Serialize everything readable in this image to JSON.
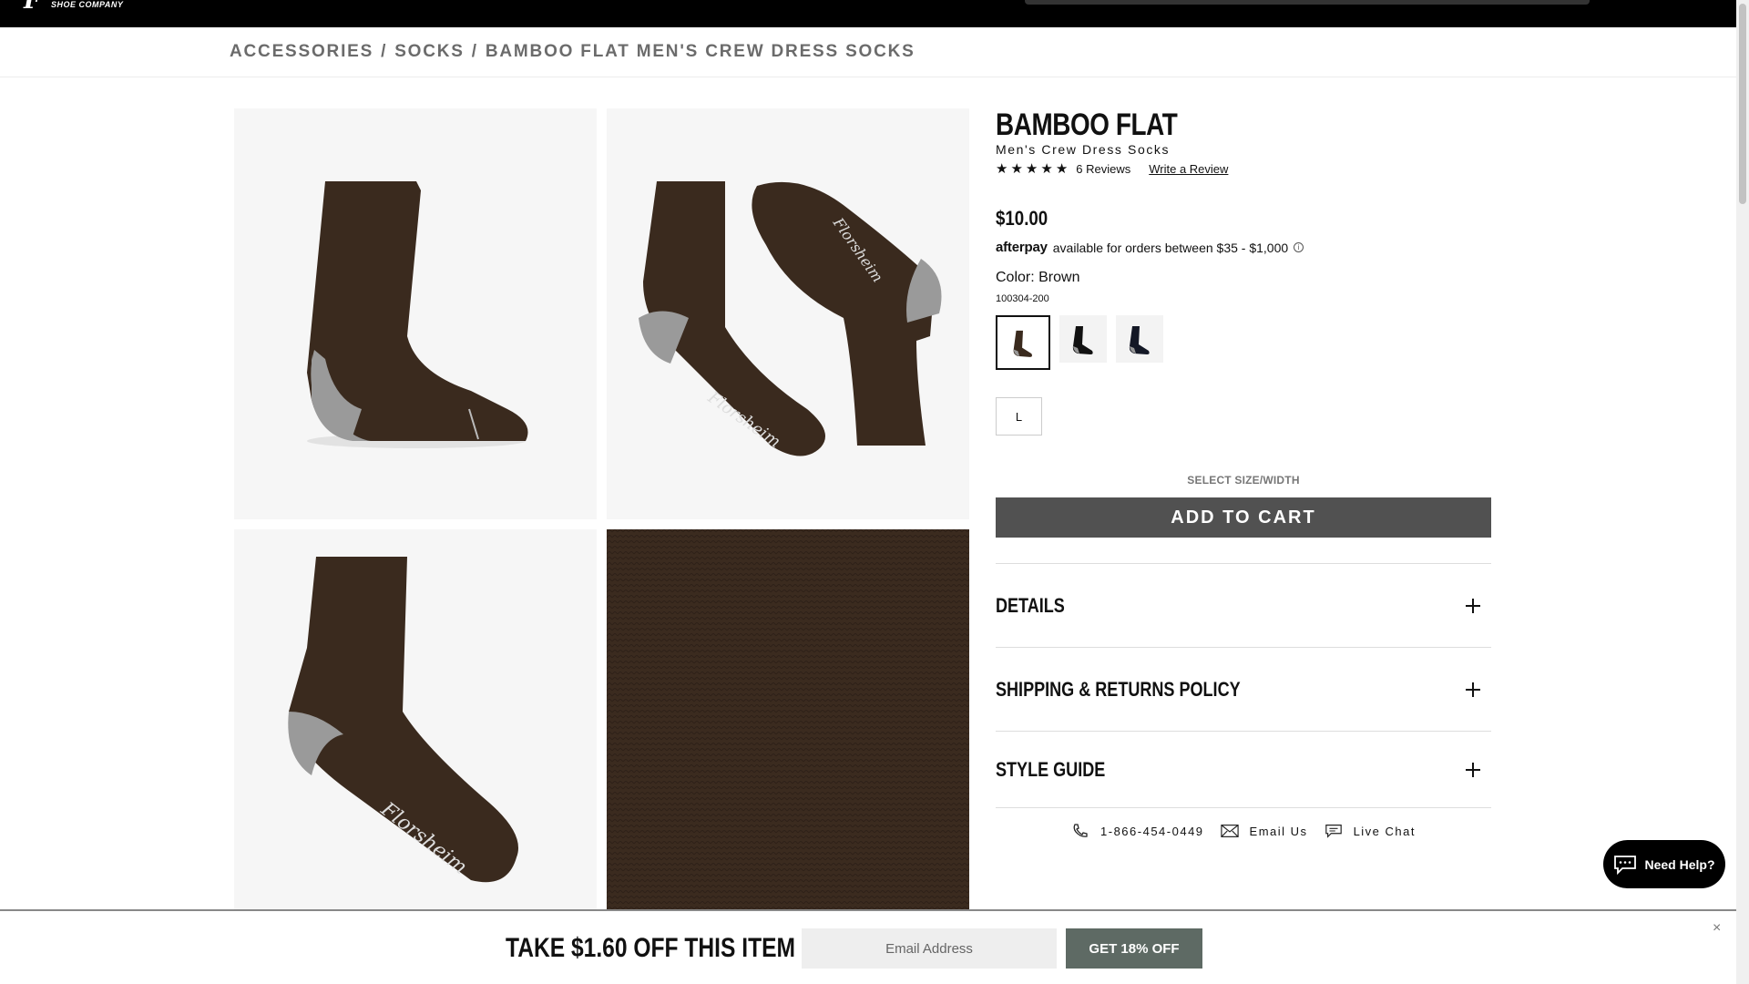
{
  "header": {
    "logo_mark": "F",
    "logo_sub": "SHOE COMPANY"
  },
  "breadcrumb": [
    "ACCESSORIES",
    "SOCKS",
    "BAMBOO FLAT MEN'S CREW DRESS SOCKS"
  ],
  "breadcrumb_sep": "/",
  "product": {
    "title": "BAMBOO FLAT",
    "subtitle": "Men's Crew Dress Socks",
    "rating": 5,
    "reviews": "6 Reviews",
    "write_review": "Write a Review",
    "price": "$10.00",
    "afterpay_logo": "afterpay",
    "afterpay_text": "available for orders between $35 - $1,000",
    "color_label": "Color: Brown",
    "sku": "100304-200",
    "size": "L",
    "select_hint": "SELECT SIZE/WIDTH",
    "add_to_cart": "ADD TO CART",
    "brand_script": "Florsheim"
  },
  "accordion": [
    "DETAILS",
    "SHIPPING & RETURNS POLICY",
    "STYLE GUIDE"
  ],
  "contact": {
    "phone": "1-866-454-0449",
    "email": "Email Us",
    "chat": "Live Chat"
  },
  "need_help": "Need Help?",
  "promo": {
    "title": "TAKE $1.60 OFF THIS ITEM",
    "placeholder": "Email Address",
    "button": "GET 18% OFF",
    "close": "×"
  },
  "colors": {
    "sock_brown": "#3a2a1e",
    "heel_gray": "#9a9a9a",
    "button_gray": "#515151",
    "promo_button": "#5e6a64"
  }
}
